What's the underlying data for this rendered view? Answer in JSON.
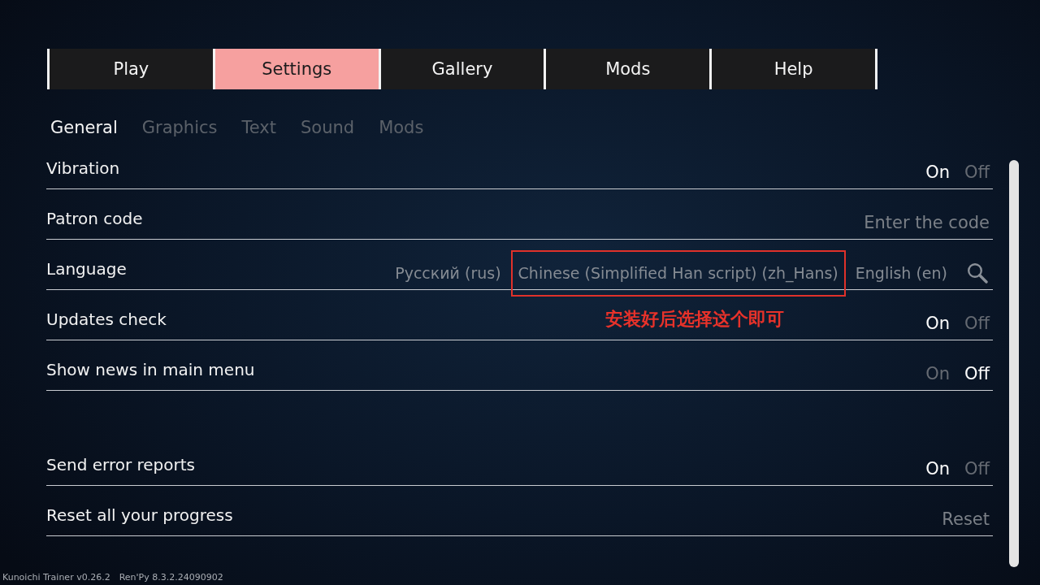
{
  "main_tabs": [
    {
      "label": "Play",
      "selected": false
    },
    {
      "label": "Settings",
      "selected": true
    },
    {
      "label": "Gallery",
      "selected": false
    },
    {
      "label": "Mods",
      "selected": false
    },
    {
      "label": "Help",
      "selected": false
    }
  ],
  "sub_tabs": [
    {
      "label": "General",
      "selected": true
    },
    {
      "label": "Graphics",
      "selected": false
    },
    {
      "label": "Text",
      "selected": false
    },
    {
      "label": "Sound",
      "selected": false
    },
    {
      "label": "Mods",
      "selected": false
    }
  ],
  "groups": [
    {
      "rows": [
        {
          "kind": "toggle",
          "label": "Vibration",
          "options": [
            {
              "label": "On",
              "selected": true
            },
            {
              "label": "Off",
              "selected": false
            }
          ]
        },
        {
          "kind": "text_input",
          "label": "Patron code",
          "placeholder": "Enter the code"
        },
        {
          "kind": "choice",
          "label": "Language",
          "options": [
            {
              "label": "Русский (rus)",
              "selected": false,
              "highlighted": false
            },
            {
              "label": "Chinese (Simplified Han script) (zh_Hans)",
              "selected": false,
              "highlighted": true,
              "note": "安装好后选择这个即可"
            },
            {
              "label": "English (en)",
              "selected": false,
              "highlighted": false
            }
          ]
        },
        {
          "kind": "toggle",
          "label": "Updates check",
          "options": [
            {
              "label": "On",
              "selected": true
            },
            {
              "label": "Off",
              "selected": false
            }
          ]
        },
        {
          "kind": "toggle",
          "label": "Show news in main menu",
          "options": [
            {
              "label": "On",
              "selected": false
            },
            {
              "label": "Off",
              "selected": true
            }
          ]
        }
      ]
    },
    {
      "rows": [
        {
          "kind": "toggle",
          "label": "Send error reports",
          "options": [
            {
              "label": "On",
              "selected": true
            },
            {
              "label": "Off",
              "selected": false
            }
          ]
        },
        {
          "kind": "action",
          "label": "Reset all your progress",
          "button": "Reset"
        }
      ]
    }
  ],
  "footer": [
    "Kunoichi Trainer v0.26.2",
    "Ren'Py 8.3.2.24090902"
  ]
}
